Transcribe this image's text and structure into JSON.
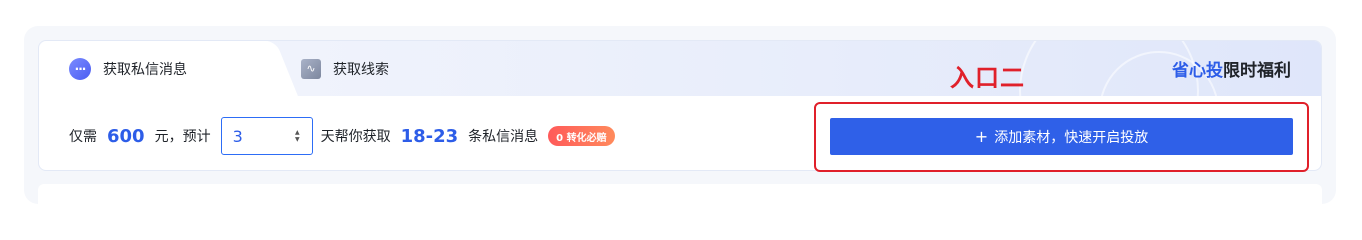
{
  "tabs": [
    {
      "label": "获取私信消息",
      "icon": "chat-bubble-icon",
      "active": true
    },
    {
      "label": "获取线索",
      "icon": "trend-icon",
      "active": false
    }
  ],
  "brand": {
    "part1": "省心投",
    "part2": "限时福利"
  },
  "annotation": {
    "label": "入口二"
  },
  "offer": {
    "prefix": "仅需",
    "price": "600",
    "mid": "元，预计",
    "days_value": "3",
    "suffix1": "天帮你获取",
    "range": "18-23",
    "suffix2": "条私信消息",
    "badge": "0 转化必赔"
  },
  "add_button": {
    "plus": "+",
    "label": "添加素材，快速开启投放"
  },
  "colors": {
    "accent": "#2d5de8",
    "button": "#2f60e8",
    "annotation_red": "#e0202a",
    "badge_start": "#ff5a5a",
    "badge_end": "#ff8a5c"
  }
}
